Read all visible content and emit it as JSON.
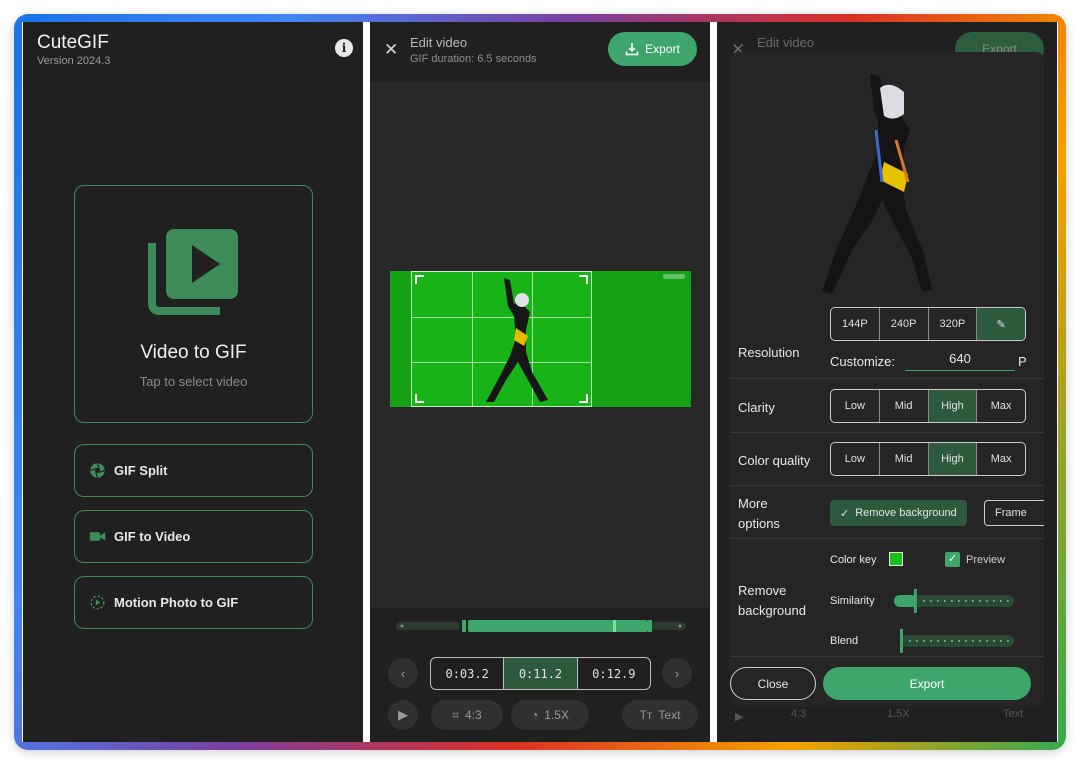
{
  "home": {
    "app_title": "CuteGIF",
    "version": "Version 2024.3",
    "main_card": {
      "title": "Video to GIF",
      "subtitle": "Tap to select video"
    },
    "options": [
      {
        "label": "GIF Split",
        "icon": "aperture-icon"
      },
      {
        "label": "GIF to Video",
        "icon": "video-camera-icon"
      },
      {
        "label": "Motion Photo to GIF",
        "icon": "motion-photo-icon"
      }
    ]
  },
  "editor": {
    "title": "Edit video",
    "subtitle": "GIF duration: 6.5 seconds",
    "export_label": "Export",
    "times": [
      "0:03.2",
      "0:11.2",
      "0:12.9"
    ],
    "active_time_index": 1,
    "tools": {
      "ratio": "4:3",
      "speed": "1.5X",
      "text": "Text"
    }
  },
  "export_sheet": {
    "header_title": "Edit video",
    "header_export": "Export",
    "resolution": {
      "label": "Resolution",
      "options": [
        "144P",
        "240P",
        "320P"
      ],
      "customize_label": "Customize:",
      "custom_value": "640",
      "unit": "P"
    },
    "clarity": {
      "label": "Clarity",
      "options": [
        "Low",
        "Mid",
        "High",
        "Max"
      ],
      "selected": "High"
    },
    "color_quality": {
      "label": "Color quality",
      "options": [
        "Low",
        "Mid",
        "High",
        "Max"
      ],
      "selected": "High"
    },
    "more_options": {
      "label_line1": "More",
      "label_line2": "options",
      "chips": [
        "Remove background",
        "Frame"
      ]
    },
    "remove_background": {
      "label_line1": "Remove",
      "label_line2": "background",
      "color_key_label": "Color key",
      "color_key_color": "#17c217",
      "preview_label": "Preview",
      "preview_checked": true,
      "similarity_label": "Similarity",
      "similarity_value": 0.17,
      "blend_label": "Blend",
      "blend_value": 0.0
    },
    "close_label": "Close",
    "export_label": "Export",
    "tools": {
      "ratio": "4:3",
      "speed": "1.5X",
      "text": "Text"
    }
  },
  "colors": {
    "accent": "#3ea66a",
    "panel_bg": "#202020",
    "chroma_green": "#17b317",
    "active_segment": "#2d5a3c"
  }
}
